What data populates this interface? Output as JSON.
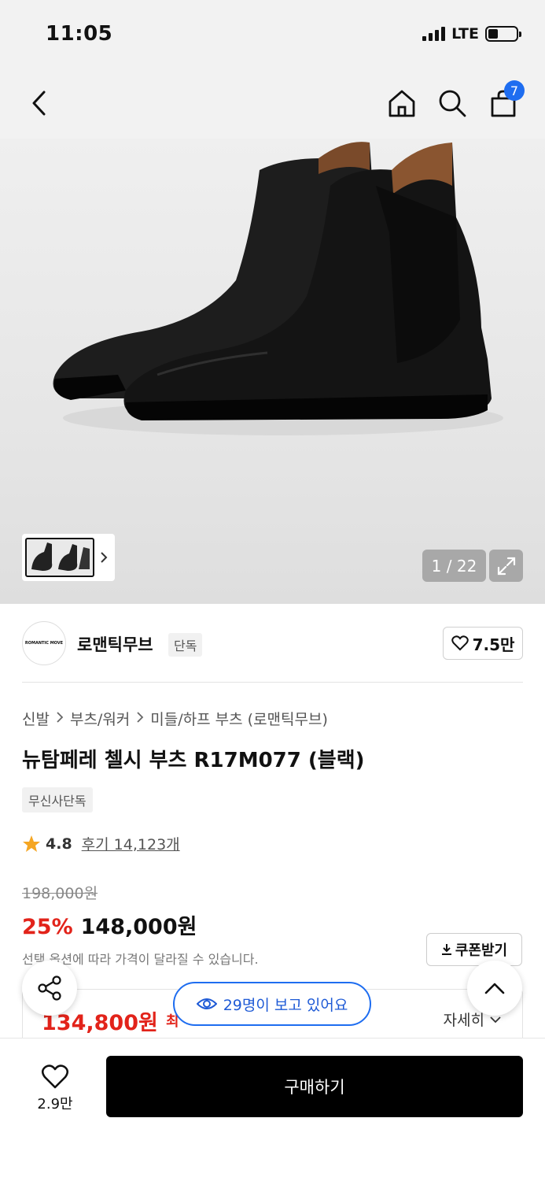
{
  "status_bar": {
    "time": "11:05",
    "network": "LTE"
  },
  "nav": {
    "cart_count": "7"
  },
  "gallery": {
    "counter": "1 / 22"
  },
  "brand": {
    "logo_text": "ROMANTIC MOVE",
    "name": "로맨틱무브",
    "tag": "단독",
    "likes": "7.5만"
  },
  "breadcrumb": [
    "신발",
    "부츠/워커",
    "미들/하프 부츠 (로맨틱무브)"
  ],
  "product": {
    "title": "뉴탐페레 첼시 부츠 R17M077 (블랙)",
    "badge": "무신사단독",
    "rating": "4.8",
    "reviews": "후기 14,123개"
  },
  "price": {
    "original": "198,000원",
    "discount": "25%",
    "sale": "148,000원",
    "note": "선택 옵션에 따라 가격이 달라질 수 있습니다.",
    "coupon_label": "쿠폰받기"
  },
  "benefit": {
    "price": "134,800원",
    "label": "최",
    "detail_label": "자세히"
  },
  "floating": {
    "viewers": "29명이 보고 있어요"
  },
  "bottom_bar": {
    "wish_count": "2.9만",
    "buy_label": "구매하기"
  },
  "colors": {
    "accent_blue": "#1e6df0",
    "sale_red": "#e2231a",
    "buy_button": "#000000"
  }
}
